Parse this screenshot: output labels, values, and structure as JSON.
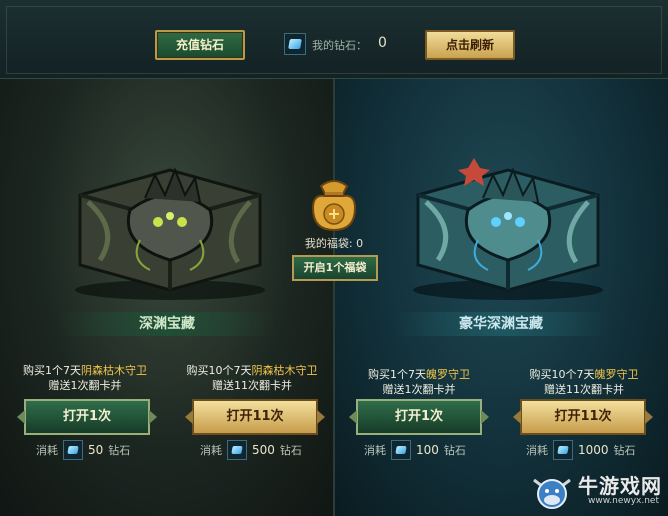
{
  "header": {
    "recharge_label": "充值钻石",
    "my_diamonds_label": "我的钻石：",
    "my_diamonds_value": "0",
    "refresh_label": "点击刷新"
  },
  "left_chest": {
    "title": "深渊宝藏",
    "single": {
      "desc_line1_prefix": "购买1个7天",
      "desc_line1_item": "阴森枯木守卫",
      "desc_line2": "赠送1次翻卡并",
      "button_label": "打开1次",
      "cost_prefix": "消耗",
      "cost_value": "50",
      "cost_unit": "钻石"
    },
    "multi": {
      "desc_line1_prefix": "购买10个7天",
      "desc_line1_item": "阴森枯木守卫",
      "desc_line2": "赠送11次翻卡并",
      "button_label": "打开11次",
      "cost_prefix": "消耗",
      "cost_value": "500",
      "cost_unit": "钻石"
    }
  },
  "right_chest": {
    "title": "豪华深渊宝藏",
    "single": {
      "desc_line1_prefix": "购买1个7天",
      "desc_line1_item": "魄罗守卫",
      "desc_line2": "赠送1次翻卡并",
      "button_label": "打开1次",
      "cost_prefix": "消耗",
      "cost_value": "100",
      "cost_unit": "钻石"
    },
    "multi": {
      "desc_line1_prefix": "购买10个7天",
      "desc_line1_item": "魄罗守卫",
      "desc_line2": "赠送11次翻卡并",
      "button_label": "打开11次",
      "cost_prefix": "消耗",
      "cost_value": "1000",
      "cost_unit": "钻石"
    }
  },
  "lucky_bag": {
    "count_label": "我的福袋: 0",
    "open_label": "开启1个福袋"
  },
  "watermark": {
    "name": "牛游戏网",
    "url": "www.newyx.net"
  },
  "colors": {
    "accent_gold": "#f3c64a",
    "button_green": "#2f6b45",
    "button_gold": "#e6c87a"
  }
}
